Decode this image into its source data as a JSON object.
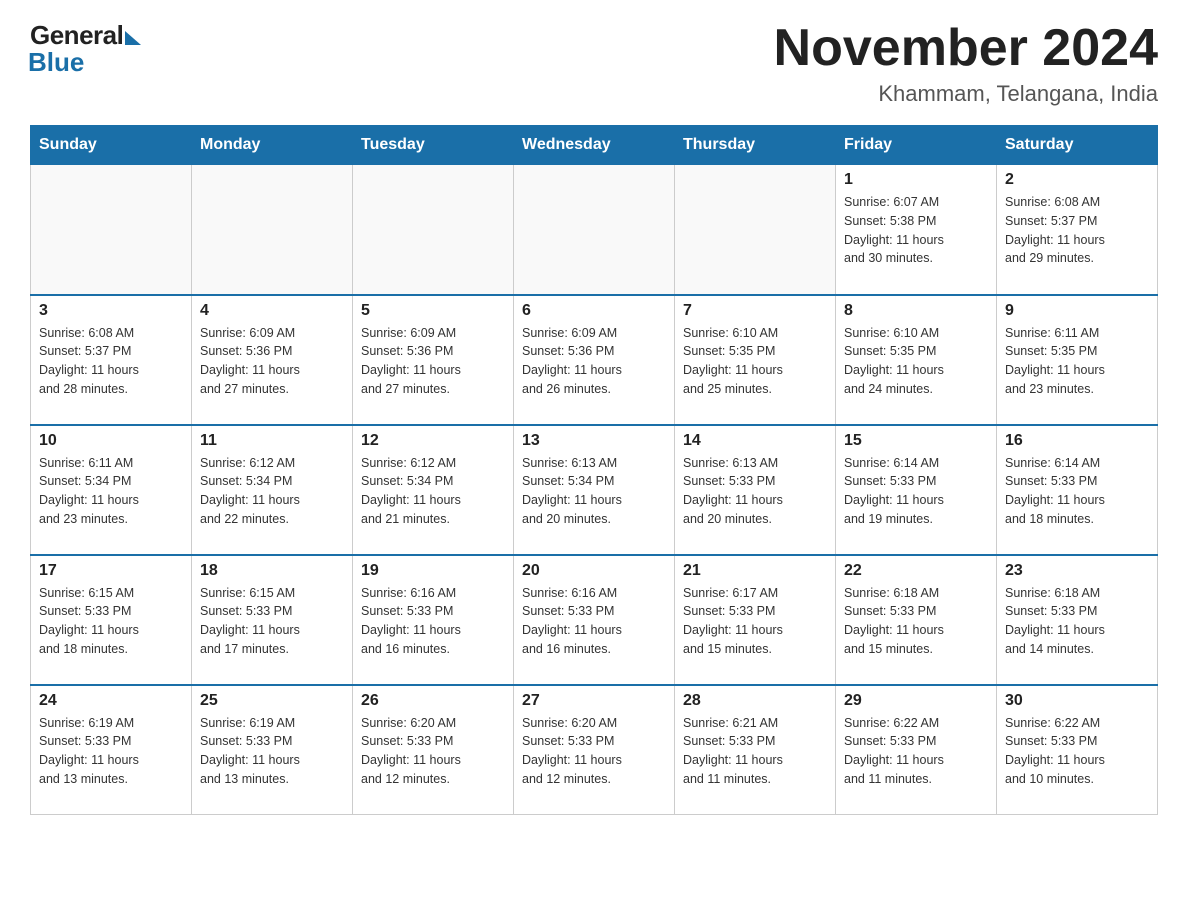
{
  "header": {
    "logo_general": "General",
    "logo_blue": "Blue",
    "month_title": "November 2024",
    "location": "Khammam, Telangana, India"
  },
  "days_of_week": [
    "Sunday",
    "Monday",
    "Tuesday",
    "Wednesday",
    "Thursday",
    "Friday",
    "Saturday"
  ],
  "weeks": [
    [
      {
        "day": "",
        "info": ""
      },
      {
        "day": "",
        "info": ""
      },
      {
        "day": "",
        "info": ""
      },
      {
        "day": "",
        "info": ""
      },
      {
        "day": "",
        "info": ""
      },
      {
        "day": "1",
        "info": "Sunrise: 6:07 AM\nSunset: 5:38 PM\nDaylight: 11 hours\nand 30 minutes."
      },
      {
        "day": "2",
        "info": "Sunrise: 6:08 AM\nSunset: 5:37 PM\nDaylight: 11 hours\nand 29 minutes."
      }
    ],
    [
      {
        "day": "3",
        "info": "Sunrise: 6:08 AM\nSunset: 5:37 PM\nDaylight: 11 hours\nand 28 minutes."
      },
      {
        "day": "4",
        "info": "Sunrise: 6:09 AM\nSunset: 5:36 PM\nDaylight: 11 hours\nand 27 minutes."
      },
      {
        "day": "5",
        "info": "Sunrise: 6:09 AM\nSunset: 5:36 PM\nDaylight: 11 hours\nand 27 minutes."
      },
      {
        "day": "6",
        "info": "Sunrise: 6:09 AM\nSunset: 5:36 PM\nDaylight: 11 hours\nand 26 minutes."
      },
      {
        "day": "7",
        "info": "Sunrise: 6:10 AM\nSunset: 5:35 PM\nDaylight: 11 hours\nand 25 minutes."
      },
      {
        "day": "8",
        "info": "Sunrise: 6:10 AM\nSunset: 5:35 PM\nDaylight: 11 hours\nand 24 minutes."
      },
      {
        "day": "9",
        "info": "Sunrise: 6:11 AM\nSunset: 5:35 PM\nDaylight: 11 hours\nand 23 minutes."
      }
    ],
    [
      {
        "day": "10",
        "info": "Sunrise: 6:11 AM\nSunset: 5:34 PM\nDaylight: 11 hours\nand 23 minutes."
      },
      {
        "day": "11",
        "info": "Sunrise: 6:12 AM\nSunset: 5:34 PM\nDaylight: 11 hours\nand 22 minutes."
      },
      {
        "day": "12",
        "info": "Sunrise: 6:12 AM\nSunset: 5:34 PM\nDaylight: 11 hours\nand 21 minutes."
      },
      {
        "day": "13",
        "info": "Sunrise: 6:13 AM\nSunset: 5:34 PM\nDaylight: 11 hours\nand 20 minutes."
      },
      {
        "day": "14",
        "info": "Sunrise: 6:13 AM\nSunset: 5:33 PM\nDaylight: 11 hours\nand 20 minutes."
      },
      {
        "day": "15",
        "info": "Sunrise: 6:14 AM\nSunset: 5:33 PM\nDaylight: 11 hours\nand 19 minutes."
      },
      {
        "day": "16",
        "info": "Sunrise: 6:14 AM\nSunset: 5:33 PM\nDaylight: 11 hours\nand 18 minutes."
      }
    ],
    [
      {
        "day": "17",
        "info": "Sunrise: 6:15 AM\nSunset: 5:33 PM\nDaylight: 11 hours\nand 18 minutes."
      },
      {
        "day": "18",
        "info": "Sunrise: 6:15 AM\nSunset: 5:33 PM\nDaylight: 11 hours\nand 17 minutes."
      },
      {
        "day": "19",
        "info": "Sunrise: 6:16 AM\nSunset: 5:33 PM\nDaylight: 11 hours\nand 16 minutes."
      },
      {
        "day": "20",
        "info": "Sunrise: 6:16 AM\nSunset: 5:33 PM\nDaylight: 11 hours\nand 16 minutes."
      },
      {
        "day": "21",
        "info": "Sunrise: 6:17 AM\nSunset: 5:33 PM\nDaylight: 11 hours\nand 15 minutes."
      },
      {
        "day": "22",
        "info": "Sunrise: 6:18 AM\nSunset: 5:33 PM\nDaylight: 11 hours\nand 15 minutes."
      },
      {
        "day": "23",
        "info": "Sunrise: 6:18 AM\nSunset: 5:33 PM\nDaylight: 11 hours\nand 14 minutes."
      }
    ],
    [
      {
        "day": "24",
        "info": "Sunrise: 6:19 AM\nSunset: 5:33 PM\nDaylight: 11 hours\nand 13 minutes."
      },
      {
        "day": "25",
        "info": "Sunrise: 6:19 AM\nSunset: 5:33 PM\nDaylight: 11 hours\nand 13 minutes."
      },
      {
        "day": "26",
        "info": "Sunrise: 6:20 AM\nSunset: 5:33 PM\nDaylight: 11 hours\nand 12 minutes."
      },
      {
        "day": "27",
        "info": "Sunrise: 6:20 AM\nSunset: 5:33 PM\nDaylight: 11 hours\nand 12 minutes."
      },
      {
        "day": "28",
        "info": "Sunrise: 6:21 AM\nSunset: 5:33 PM\nDaylight: 11 hours\nand 11 minutes."
      },
      {
        "day": "29",
        "info": "Sunrise: 6:22 AM\nSunset: 5:33 PM\nDaylight: 11 hours\nand 11 minutes."
      },
      {
        "day": "30",
        "info": "Sunrise: 6:22 AM\nSunset: 5:33 PM\nDaylight: 11 hours\nand 10 minutes."
      }
    ]
  ]
}
